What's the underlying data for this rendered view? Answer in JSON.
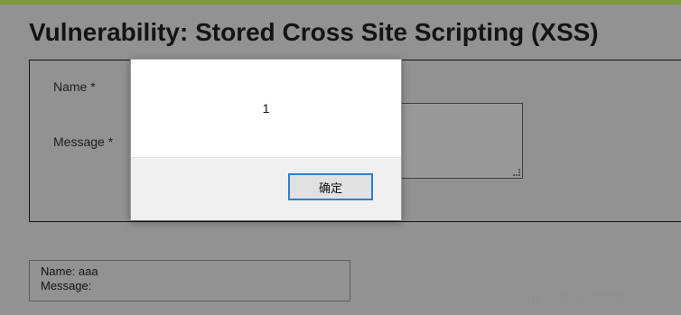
{
  "page": {
    "title": "Vulnerability: Stored Cross Site Scripting (XSS)"
  },
  "form": {
    "name_label": "Name *",
    "message_label": "Message *"
  },
  "guestbook_entry": {
    "name_line": "Name: aaa",
    "message_line": "Message:"
  },
  "dialog": {
    "message": "1",
    "ok_label": "确定"
  },
  "watermark": "CSDN @未完成的歌~",
  "colors": {
    "top_bar": "#7a9a3c",
    "dialog_button_border": "#2f7fd0"
  }
}
